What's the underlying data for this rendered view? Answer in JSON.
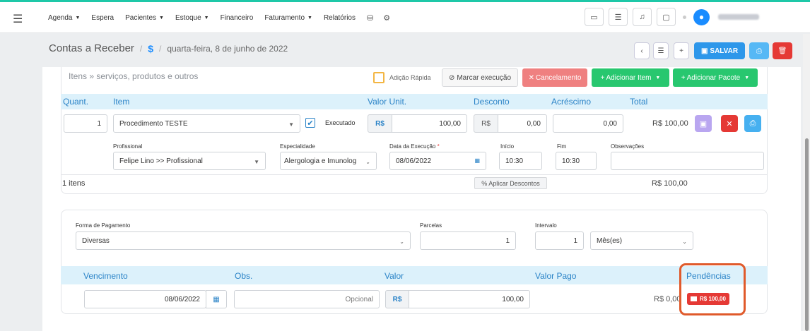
{
  "nav": {
    "items": [
      {
        "label": "Agenda",
        "dropdown": true
      },
      {
        "label": "Espera",
        "dropdown": false
      },
      {
        "label": "Pacientes",
        "dropdown": true
      },
      {
        "label": "Estoque",
        "dropdown": true
      },
      {
        "label": "Financeiro",
        "dropdown": false
      },
      {
        "label": "Faturamento",
        "dropdown": true
      },
      {
        "label": "Relatórios",
        "dropdown": false
      }
    ]
  },
  "header": {
    "title": "Contas a Receber",
    "symbol": "$",
    "date": "quarta-feira, 8 de junho de 2022",
    "save_label": "SALVAR"
  },
  "items": {
    "title": "Itens » serviços, produtos e outros",
    "quick_add": "Adição Rápida",
    "mark_exec": "Marcar execução",
    "cancel": "Cancelamento",
    "add_item": "Adicionar Item",
    "add_package": "Adicionar Pacote",
    "columns": [
      "Quant.",
      "Item",
      "Valor Unit.",
      "Desconto",
      "Acréscimo",
      "Total"
    ],
    "row": {
      "qty": "1",
      "item": "Procedimento TESTE",
      "executed_label": "Executado",
      "executed": true,
      "currency": "R$",
      "unit_value": "100,00",
      "discount_currency": "R$",
      "discount": "0,00",
      "increase": "0,00",
      "total": "R$ 100,00"
    },
    "details": {
      "professional_label": "Profissional",
      "professional": "Felipe Lino >> Profissional",
      "specialty_label": "Especialidade",
      "specialty": "Alergologia e Imunolog",
      "exec_date_label": "Data da Execução",
      "exec_date": "08/06/2022",
      "start_label": "Início",
      "start": "10:30",
      "end_label": "Fim",
      "end": "10:30",
      "notes_label": "Observações",
      "notes": ""
    },
    "count": "1 itens",
    "apply_discounts": "Aplicar Descontos",
    "total": "R$ 100,00"
  },
  "payment": {
    "method_label": "Forma de Pagamento",
    "method": "Diversas",
    "installments_label": "Parcelas",
    "installments": "1",
    "interval_label": "Intervalo",
    "interval": "1",
    "interval_unit": "Mês(es)",
    "columns": [
      "Vencimento",
      "Obs.",
      "Valor",
      "Valor Pago",
      "Pendências"
    ],
    "row": {
      "due_date": "08/06/2022",
      "obs_placeholder": "Opcional",
      "currency": "R$",
      "value": "100,00",
      "paid": "R$ 0,00",
      "pending": "R$ 100,00"
    }
  },
  "colors": {
    "accent": "#2d97ea",
    "success": "#28c76f",
    "danger": "#e53935",
    "highlight": "#e05a2b"
  }
}
